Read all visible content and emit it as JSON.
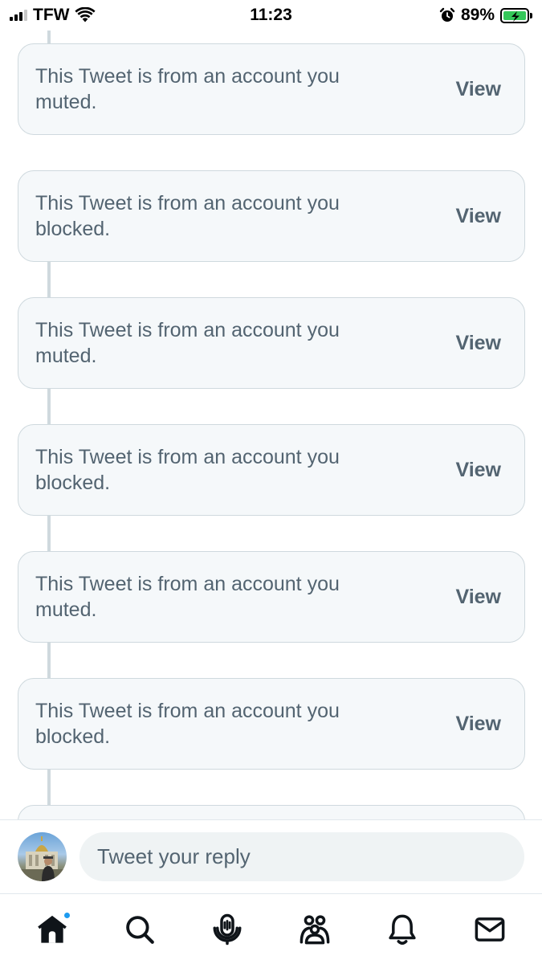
{
  "status_bar": {
    "carrier": "TFW",
    "time": "11:23",
    "battery": "89%",
    "battery_level": 0.89,
    "icons": [
      "signal-icon",
      "wifi-icon",
      "alarm-icon",
      "battery-charging-icon"
    ]
  },
  "thread": {
    "cards": [
      {
        "text": "This Tweet is from an account you muted.",
        "action": "View"
      },
      {
        "text": "This Tweet is from an account you blocked.",
        "action": "View"
      },
      {
        "text": "This Tweet is from an account you muted.",
        "action": "View"
      },
      {
        "text": "This Tweet is from an account you blocked.",
        "action": "View"
      },
      {
        "text": "This Tweet is from an account you muted.",
        "action": "View"
      },
      {
        "text": "This Tweet is from an account you blocked.",
        "action": "View"
      }
    ]
  },
  "reply": {
    "placeholder": "Tweet your reply"
  },
  "tab_bar": {
    "tabs": [
      {
        "icon": "home-icon",
        "active": true,
        "has_badge": true
      },
      {
        "icon": "search-icon",
        "active": false
      },
      {
        "icon": "spaces-icon",
        "active": false
      },
      {
        "icon": "communities-icon",
        "active": false
      },
      {
        "icon": "notifications-icon",
        "active": false
      },
      {
        "icon": "messages-icon",
        "active": false
      }
    ]
  },
  "colors": {
    "accent": "#1d9bf0",
    "card_bg": "#f5f8fa",
    "card_border": "#cfd9de",
    "secondary_text": "#536471",
    "battery_green": "#34c759"
  }
}
